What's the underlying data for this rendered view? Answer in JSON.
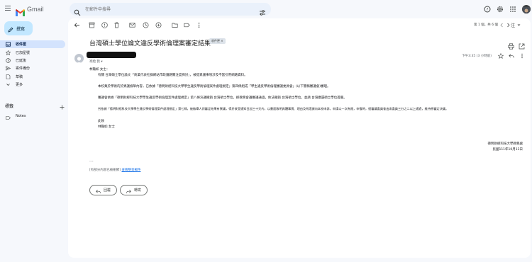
{
  "app": {
    "name": "Gmail"
  },
  "search": {
    "placeholder": "在郵件中搜尋"
  },
  "compose": {
    "label": "撰寫"
  },
  "nav": [
    {
      "label": "收件匣",
      "icon": "inbox-icon",
      "active": true
    },
    {
      "label": "已加星號",
      "icon": "star-icon",
      "active": false
    },
    {
      "label": "已延後",
      "icon": "clock-icon",
      "active": false
    },
    {
      "label": "寄件備份",
      "icon": "send-icon",
      "active": false
    },
    {
      "label": "草稿",
      "icon": "draft-icon",
      "active": false
    },
    {
      "label": "更多",
      "icon": "chevron-down-icon",
      "active": false
    }
  ],
  "labels": {
    "title": "標籤",
    "items": [
      {
        "label": "Notes"
      }
    ]
  },
  "toolbar": {
    "pager": "第 1 個，共 6 個",
    "lang": "注"
  },
  "message": {
    "subject": "台灣碩士學位論文違反學術倫理案審定結果",
    "folder_chip": "收件匣 ×",
    "to": "寄給 我",
    "date": "下午3:35 (3 小時前)",
    "greeting": "林豔如 女士：",
    "paragraphs": [
      "有關 台灣碩士學位論文「商業代表社群網站市政議題關注度探討」，被提異議事項涉及不當引用網路資料。",
      "本校業於學術的於異議檢舉內容，已依據「德明財經科技大學學生違反學術倫理案件處理規定」第四條組成「學生違反學術倫理審議委員會」(以下簡稱審議會)審理。",
      "審議會依據「德明財經科技大學學生違反學術倫理案件處理規定」第八條決議撤銷 台灣碩士學位，經教務會議審議通過，依法撤銷 台灣碩士學位，並請 台灣繳還碩士學位證書。",
      "另依據「德明財經科技大學學生違反學術倫理案件處理規定」第七條，被檢舉人對審定結果有異議，得於收受通知日起三十天內，以書面敘明具體事實、理由及附證據向本校申訴，申請以一次為限，申復時，經審議委員會出席委員三分之二以上通過，維持原審定決議。"
    ],
    "closing": [
      "此致",
      "林豔如 女士"
    ],
    "signature": [
      "德明財經科技大學教務處",
      "民國111年10月13日"
    ],
    "dots": "...",
    "footer_prefix": "[有部分內容已被刪節]",
    "footer_link": "查看整封郵件"
  },
  "actions": {
    "reply": "回覆",
    "forward": "轉寄"
  }
}
